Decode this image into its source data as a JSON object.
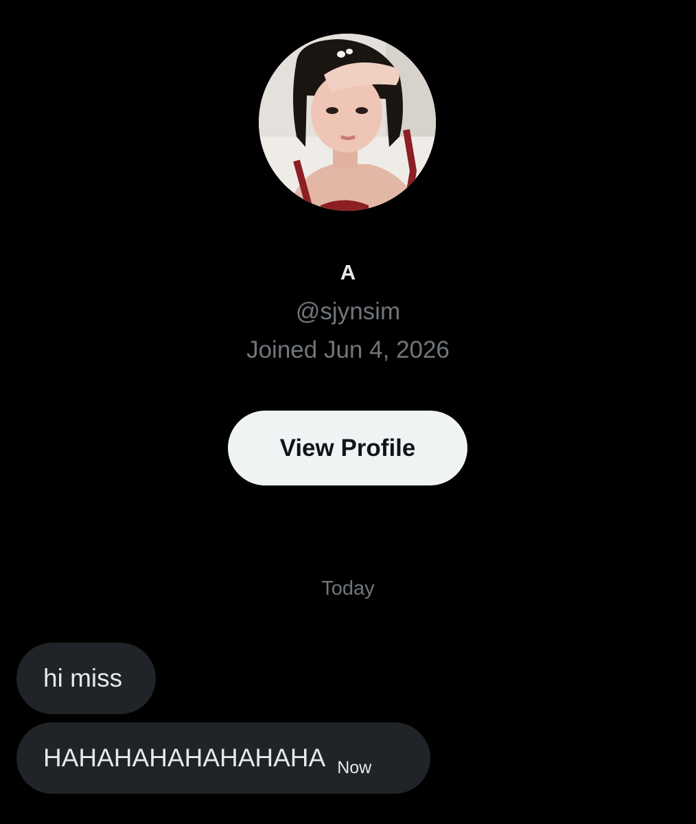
{
  "profile": {
    "display_name": "A",
    "handle": "@sjynsim",
    "joined": "Joined Jun 4, 2026",
    "view_profile_label": "View Profile"
  },
  "conversation": {
    "date_separator": "Today",
    "messages": [
      {
        "text": "hi miss",
        "time": ""
      },
      {
        "text": "HAHAHAHAHAHAHAHA",
        "time": "Now"
      }
    ]
  },
  "colors": {
    "background": "#000000",
    "primary_text": "#e7e9ea",
    "secondary_text": "#71767b",
    "button_bg": "#eff3f4",
    "button_text": "#0f1419",
    "bubble_bg": "#202327"
  }
}
